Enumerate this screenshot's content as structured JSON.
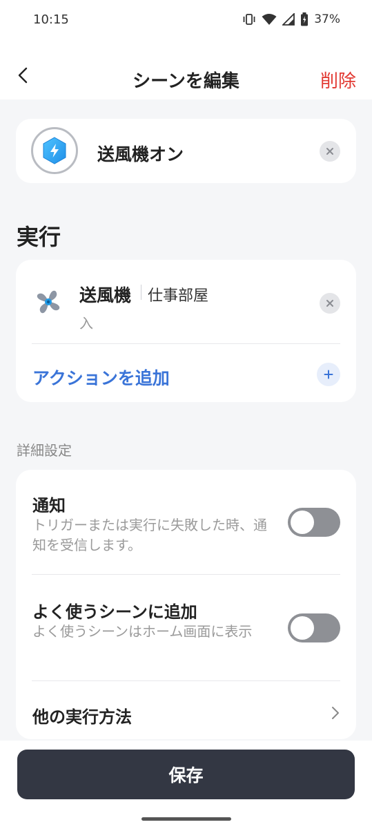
{
  "status": {
    "time": "10:15",
    "battery": "37%"
  },
  "header": {
    "title": "シーンを編集",
    "delete_label": "削除"
  },
  "scene": {
    "name": "送風機オン"
  },
  "execute": {
    "section_title": "実行",
    "device_name": "送風機",
    "room": "仕事部屋",
    "state": "入",
    "add_action_label": "アクションを追加"
  },
  "advanced": {
    "label": "詳細設定",
    "notification": {
      "title": "通知",
      "subtitle": "トリガーまたは実行に失敗した時、通知を受信します。",
      "enabled": false
    },
    "favorites": {
      "title": "よく使うシーンに追加",
      "subtitle": "よく使うシーンはホーム画面に表示",
      "enabled": false
    },
    "other_methods": {
      "title": "他の実行方法"
    }
  },
  "footer": {
    "save_label": "保存"
  },
  "colors": {
    "accent": "#3a74d8",
    "danger": "#e23a33",
    "save_button": "#333743"
  }
}
